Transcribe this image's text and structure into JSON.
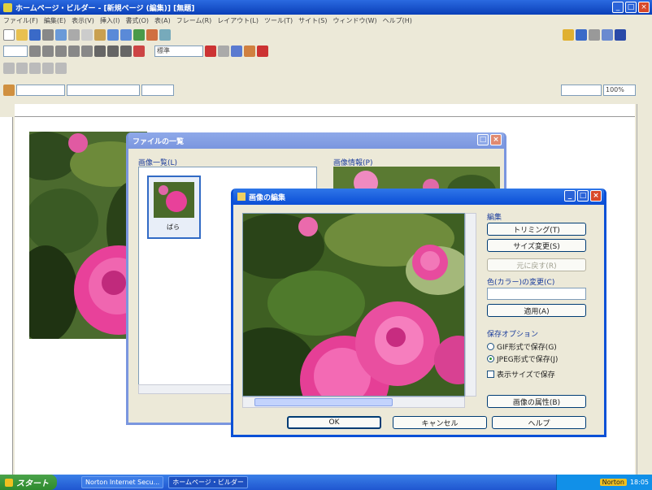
{
  "app": {
    "title": "ホームページ・ビルダー - [新規ページ (編集)] [無題]",
    "menu": [
      "ファイル(F)",
      "編集(E)",
      "表示(V)",
      "挿入(I)",
      "書式(O)",
      "表(A)",
      "フレーム(R)",
      "レイアウト(L)",
      "ツール(T)",
      "サイト(S)",
      "ウィンドウ(W)",
      "ヘルプ(H)"
    ],
    "font_select": "標準",
    "size_select": "100%"
  },
  "list_dialog": {
    "title": "ファイルの一覧",
    "list_label": "画像一覧(L)",
    "preview_label": "画像情報(P)",
    "thumb_caption": "ばら"
  },
  "image_dialog": {
    "title": "画像の編集",
    "edit_group": "編集",
    "buttons": {
      "trim": "トリミング(T)",
      "resize": "サイズ変更(S)",
      "revert": "元に戻す(R)",
      "apply": "適用(A)",
      "ok": "OK",
      "cancel": "キャンセル",
      "help": "ヘルプ",
      "properties": "画像の属性(B)"
    },
    "save_group": "保存オプション",
    "radio_gif": "GIF形式で保存(G)",
    "radio_jpg": "JPEG形式で保存(J)",
    "check_size": "表示サイズで保存",
    "color_label": "色(カラー)の変更(C)"
  },
  "taskbar": {
    "start": "スタート",
    "task1": "Norton Internet Secu...",
    "task2": "ホームページ・ビルダー",
    "norton": "Norton",
    "clock": "18:05"
  }
}
